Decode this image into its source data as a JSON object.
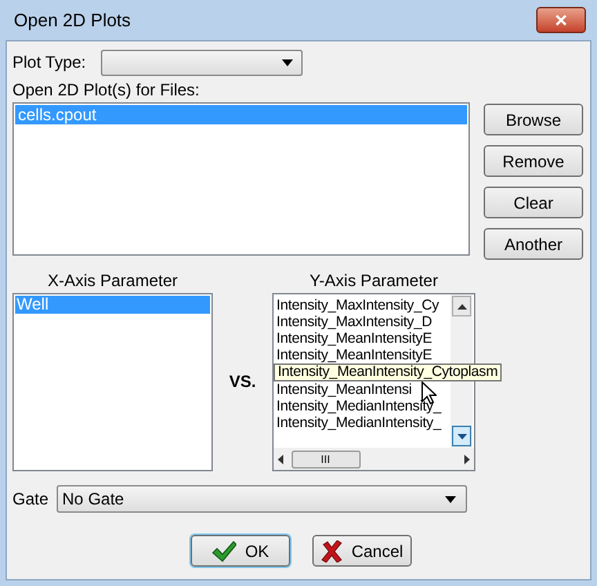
{
  "window": {
    "title": "Open 2D Plots",
    "close": "✕"
  },
  "plot_type": {
    "label": "Plot Type:"
  },
  "files": {
    "label": "Open 2D Plot(s) for Files:",
    "items": [
      {
        "text": "cells.cpout",
        "selected": true
      }
    ]
  },
  "side_buttons": [
    "Browse",
    "Remove",
    "Clear",
    "Another"
  ],
  "x_axis": {
    "label": "X-Axis Parameter",
    "items": [
      {
        "text": "Well",
        "selected": true
      }
    ]
  },
  "vs": "VS.",
  "y_axis": {
    "label": "Y-Axis Parameter",
    "items": [
      {
        "kind": "row",
        "text": "Intensity_MaxIntensity_Cy"
      },
      {
        "kind": "row",
        "text": "Intensity_MaxIntensity_D"
      },
      {
        "kind": "row",
        "text": "Intensity_MeanIntensityE"
      },
      {
        "kind": "row",
        "text": "Intensity_MeanIntensityE"
      },
      {
        "kind": "tooltip",
        "text": "Intensity_MeanIntensity_Cytoplasm"
      },
      {
        "kind": "row",
        "text": "Intensity_MeanIntensi"
      },
      {
        "kind": "row",
        "text": "Intensity_MedianIntensity_"
      },
      {
        "kind": "row",
        "text": "Intensity_MedianIntensity_"
      }
    ],
    "hscroll_grip": "III"
  },
  "gate": {
    "label": "Gate",
    "value": "No Gate"
  },
  "buttons": [
    {
      "kind": "ok",
      "label": "OK"
    },
    {
      "kind": "cancel",
      "label": "Cancel"
    }
  ]
}
